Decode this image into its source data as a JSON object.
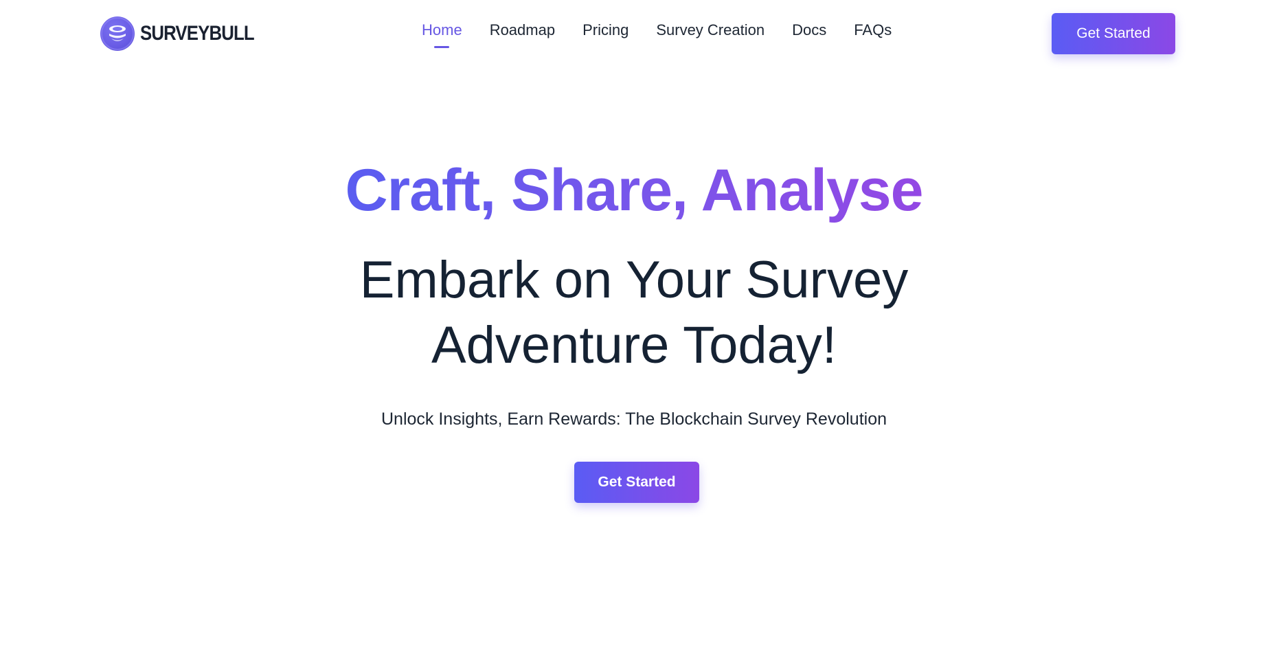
{
  "brand": {
    "name": "SURVEYBULL",
    "logo_icon": "globe-logo-icon"
  },
  "nav": {
    "items": [
      {
        "label": "Home",
        "active": true
      },
      {
        "label": "Roadmap",
        "active": false
      },
      {
        "label": "Pricing",
        "active": false
      },
      {
        "label": "Survey Creation",
        "active": false
      },
      {
        "label": "Docs",
        "active": false
      },
      {
        "label": "FAQs",
        "active": false
      }
    ]
  },
  "header": {
    "cta_label": "Get Started"
  },
  "hero": {
    "tagline": "Craft, Share, Analyse",
    "headline_line1": "Embark on Your Survey",
    "headline_line2": "Adventure Today!",
    "subtitle": "Unlock Insights, Earn Rewards: The Blockchain Survey Revolution",
    "cta_label": "Get Started"
  },
  "colors": {
    "accent_start": "#5a5cf4",
    "accent_end": "#8b48e6",
    "active_nav": "#6657e3",
    "text_dark": "#152233"
  }
}
